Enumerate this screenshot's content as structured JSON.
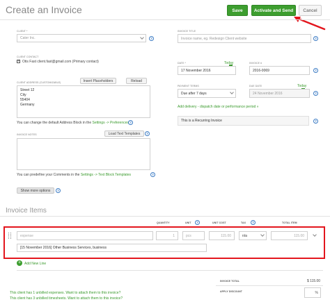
{
  "header": {
    "title": "Create an Invoice",
    "save_label": "Save",
    "activate_label": "Activate and Send",
    "cancel_label": "Cancel"
  },
  "client": {
    "label": "Client *",
    "value": "Cater Inc.",
    "contact_label": "Client contact",
    "contact_value": "Otis Fast client.fast@gmail.com (Primary contact)"
  },
  "address": {
    "label": "Client address (customizable)",
    "insert_placeholders_label": "Insert Placeholders",
    "reload_label": "Reload",
    "lines": [
      "Street 12",
      "City",
      "55404",
      "Germany"
    ],
    "help_text": "You can change the default Address Block in the",
    "help_link": "Settings -> Preferences"
  },
  "notes": {
    "label": "Invoice notes",
    "load_templates_label": "Load Text Templates",
    "help_text": "You can predefine your Comments in the",
    "help_link": "Settings -> Text Block Templates",
    "show_more_label": "Show more options"
  },
  "invoice_title": {
    "label": "Invoice title",
    "placeholder": "Invoice name, eg. Redesign Client website"
  },
  "date": {
    "label": "Date *",
    "today_label": "Today",
    "value": "17 November 2016"
  },
  "invoice_number": {
    "label": "Invoice #",
    "value": "2016-0069"
  },
  "payment_terms": {
    "label": "Payment terms",
    "value": "Due after 7 days"
  },
  "due_date": {
    "label": "Due date",
    "today_label": "Today",
    "value": "24 November 2016"
  },
  "delivery_link": "Add delivery - dispatch date or performance period »",
  "recurring_label": "This is a Recurring Invoice",
  "items": {
    "heading": "Invoice Items",
    "columns": [
      "Quantity",
      "Unit",
      "Unit cost",
      "Tax",
      "Total item"
    ],
    "row": {
      "name_placeholder": "expense",
      "quantity": "1",
      "unit": "pcs",
      "unit_cost": "115.00",
      "tax": "n/a",
      "total": "115.00",
      "description": "[15 November 2016] Other Business Services, business"
    },
    "add_line_label": "Add New Line"
  },
  "totals": {
    "invoice_total_label": "Invoice total",
    "invoice_total_value": "$ 115.00",
    "discount_label": "Apply discount",
    "discount_unit": "%"
  },
  "notices": [
    "This client has 1 unbilled expenses. Want to attach them to this invoice?",
    "This client has 3 unbilled timesheets. Want to attach them to this invoice?"
  ],
  "colors": {
    "accent_green": "#3d9e2f",
    "highlight_red": "#e3151d",
    "help_blue": "#3b7bc4"
  }
}
